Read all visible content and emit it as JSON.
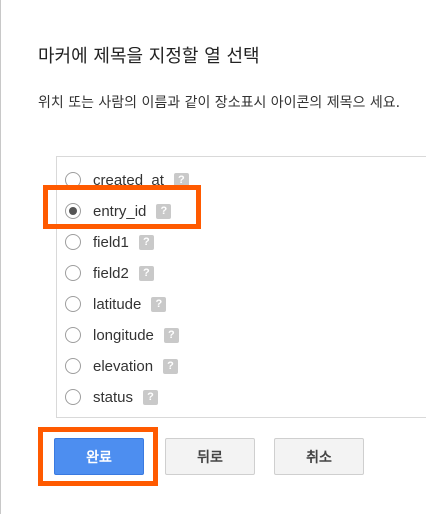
{
  "dialog": {
    "title": "마커에 제목을 지정할 열 선택",
    "description": "위치 또는 사람의 이름과 같이 장소표시 아이콘의 제목으 세요.",
    "help_glyph": "?",
    "options": [
      {
        "label": "created_at",
        "selected": false
      },
      {
        "label": "entry_id",
        "selected": true
      },
      {
        "label": "field1",
        "selected": false
      },
      {
        "label": "field2",
        "selected": false
      },
      {
        "label": "latitude",
        "selected": false
      },
      {
        "label": "longitude",
        "selected": false
      },
      {
        "label": "elevation",
        "selected": false
      },
      {
        "label": "status",
        "selected": false
      }
    ],
    "buttons": {
      "done": "완료",
      "back": "뒤로",
      "cancel": "취소"
    }
  },
  "colors": {
    "primary_button": "#4d8ef0",
    "highlight": "#ff5a00"
  }
}
